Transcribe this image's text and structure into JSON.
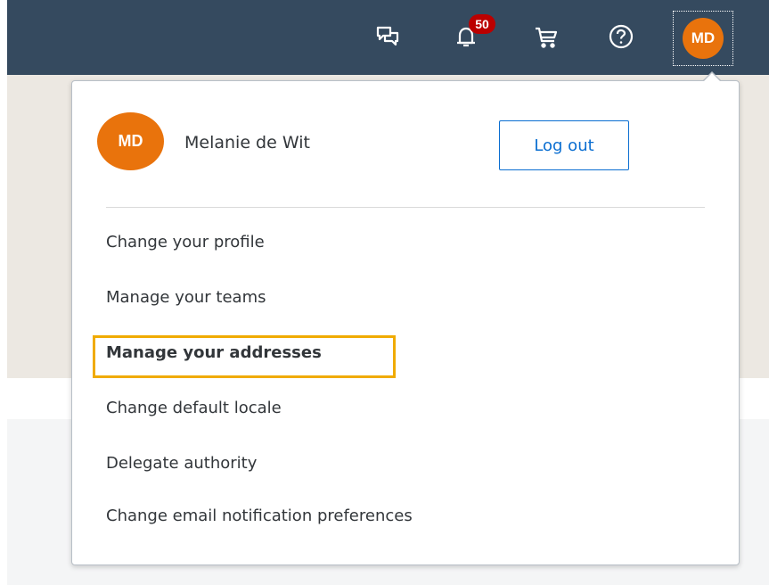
{
  "header": {
    "notification_count": "50",
    "user_initials": "MD",
    "icons": [
      "chat-icon",
      "bell-icon",
      "cart-icon",
      "help-icon"
    ]
  },
  "popover": {
    "user_initials": "MD",
    "user_name": "Melanie de Wit",
    "logout_label": "Log out",
    "menu_items": [
      {
        "label": "Change your profile"
      },
      {
        "label": "Manage your teams"
      },
      {
        "label": "Manage your addresses",
        "highlighted": true
      },
      {
        "label": "Change default locale"
      },
      {
        "label": "Delegate authority"
      },
      {
        "label": "Change email notification preferences"
      }
    ]
  },
  "colors": {
    "header_bg": "#354a5f",
    "avatar": "#e9730c",
    "badge": "#bb0000",
    "accent": "#0a6ed1",
    "highlight": "#f0ab00"
  }
}
